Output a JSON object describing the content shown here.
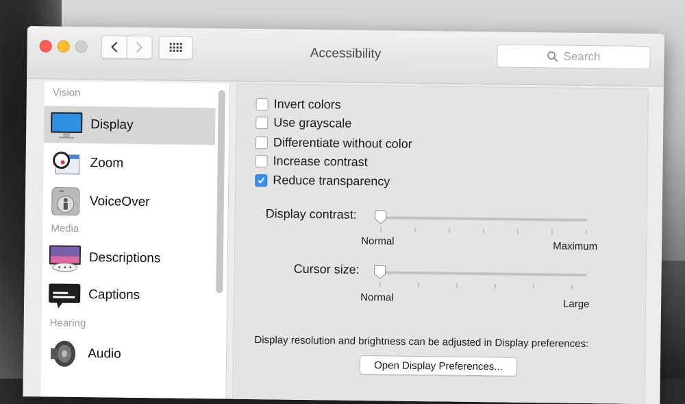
{
  "window": {
    "title": "Accessibility",
    "search_placeholder": "Search"
  },
  "sidebar": {
    "sections": [
      {
        "label": "Vision"
      },
      {
        "label": "Media"
      },
      {
        "label": "Hearing"
      }
    ],
    "items": [
      {
        "label": "Display",
        "icon": "display-icon",
        "selected": true
      },
      {
        "label": "Zoom",
        "icon": "zoom-icon"
      },
      {
        "label": "VoiceOver",
        "icon": "voiceover-icon"
      },
      {
        "label": "Descriptions",
        "icon": "descriptions-icon"
      },
      {
        "label": "Captions",
        "icon": "captions-icon"
      },
      {
        "label": "Audio",
        "icon": "audio-icon"
      }
    ]
  },
  "display": {
    "options": [
      {
        "label": "Invert colors",
        "checked": false
      },
      {
        "label": "Use grayscale",
        "checked": false
      },
      {
        "label": "Differentiate without color",
        "checked": false
      },
      {
        "label": "Increase contrast",
        "checked": false
      },
      {
        "label": "Reduce transparency",
        "checked": true
      }
    ],
    "contrast": {
      "label": "Display contrast:",
      "min_label": "Normal",
      "max_label": "Maximum",
      "value": 0
    },
    "cursor": {
      "label": "Cursor size:",
      "min_label": "Normal",
      "max_label": "Large",
      "value": 0
    },
    "note": "Display resolution and brightness can be adjusted in Display preferences:",
    "open_prefs_button": "Open Display Preferences..."
  },
  "colors": {
    "accent": "#3a8ff3",
    "close": "#fc5f57",
    "minimize": "#fdbc2e"
  }
}
